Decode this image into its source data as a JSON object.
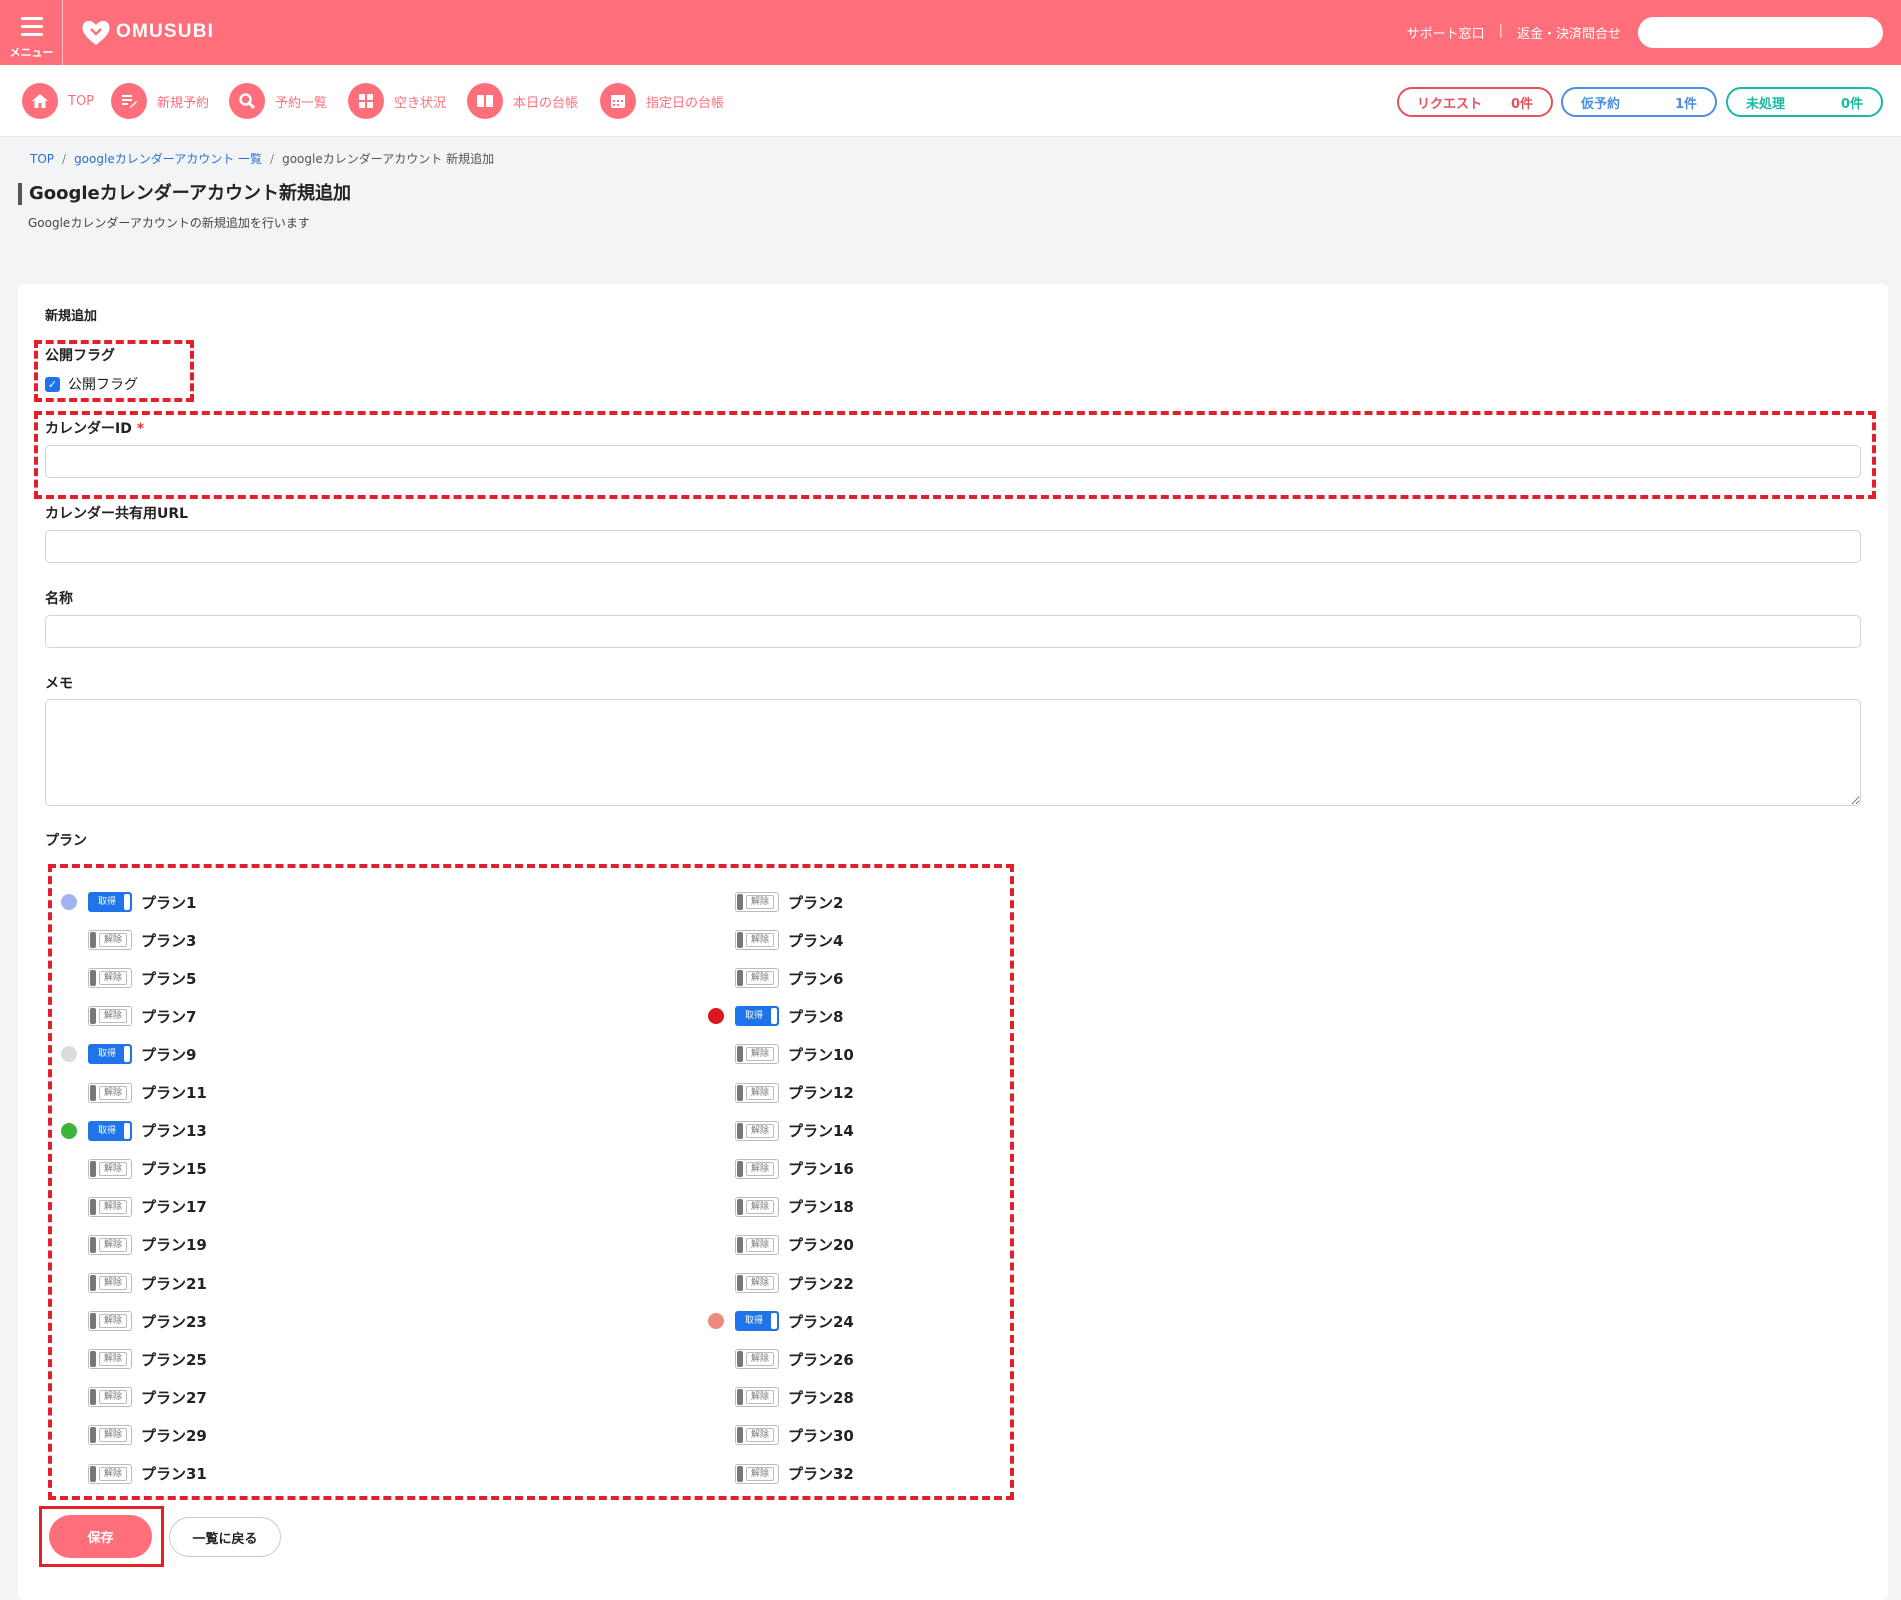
{
  "header": {
    "menu_label": "メニュー",
    "logo_text": "OMUSUBI",
    "support_link": "サポート窓口",
    "separator": "|",
    "refund_link": "返金・決済問合せ"
  },
  "nav": {
    "items": [
      {
        "label": "TOP",
        "icon": "home-icon"
      },
      {
        "label": "新規予約",
        "icon": "edit-icon"
      },
      {
        "label": "予約一覧",
        "icon": "search-icon"
      },
      {
        "label": "空き状況",
        "icon": "grid-icon"
      },
      {
        "label": "本日の台帳",
        "icon": "book-icon"
      },
      {
        "label": "指定日の台帳",
        "icon": "calendar-icon"
      }
    ]
  },
  "status": {
    "request": {
      "label": "リクエスト",
      "count": "0件",
      "color": "#e8505b"
    },
    "provisional": {
      "label": "仮予約",
      "count": "1件",
      "color": "#4a90e2"
    },
    "unprocessed": {
      "label": "未処理",
      "count": "0件",
      "color": "#17b8a6"
    }
  },
  "breadcrumb": {
    "top": "TOP",
    "sep": "/",
    "list": "googleカレンダーアカウント 一覧",
    "current": "googleカレンダーアカウント 新規追加"
  },
  "page": {
    "title": "Googleカレンダーアカウント新規追加",
    "subtitle": "Googleカレンダーアカウントの新規追加を行います"
  },
  "form": {
    "section_title": "新規追加",
    "public_flag_label": "公開フラグ",
    "public_flag_checkbox": "公開フラグ",
    "public_flag_checked": true,
    "calendar_id_label": "カレンダーID",
    "required_mark": "*",
    "calendar_id_value": "",
    "share_url_label": "カレンダー共有用URL",
    "share_url_value": "",
    "name_label": "名称",
    "name_value": "",
    "memo_label": "メモ",
    "memo_value": "",
    "plan_label": "プラン"
  },
  "plans": {
    "on_text": "取得",
    "off_text": "解除",
    "items": [
      {
        "name": "プラン1",
        "on": true,
        "dot": "#9fb4f0"
      },
      {
        "name": "プラン2",
        "on": false
      },
      {
        "name": "プラン3",
        "on": false
      },
      {
        "name": "プラン4",
        "on": false
      },
      {
        "name": "プラン5",
        "on": false
      },
      {
        "name": "プラン6",
        "on": false
      },
      {
        "name": "プラン7",
        "on": false
      },
      {
        "name": "プラン8",
        "on": true,
        "dot": "#d9191f"
      },
      {
        "name": "プラン9",
        "on": true,
        "dot": "#dcdcdc"
      },
      {
        "name": "プラン10",
        "on": false
      },
      {
        "name": "プラン11",
        "on": false
      },
      {
        "name": "プラン12",
        "on": false
      },
      {
        "name": "プラン13",
        "on": true,
        "dot": "#3cb43c"
      },
      {
        "name": "プラン14",
        "on": false
      },
      {
        "name": "プラン15",
        "on": false
      },
      {
        "name": "プラン16",
        "on": false
      },
      {
        "name": "プラン17",
        "on": false
      },
      {
        "name": "プラン18",
        "on": false
      },
      {
        "name": "プラン19",
        "on": false
      },
      {
        "name": "プラン20",
        "on": false
      },
      {
        "name": "プラン21",
        "on": false
      },
      {
        "name": "プラン22",
        "on": false
      },
      {
        "name": "プラン23",
        "on": false
      },
      {
        "name": "プラン24",
        "on": true,
        "dot": "#f08a7e"
      },
      {
        "name": "プラン25",
        "on": false
      },
      {
        "name": "プラン26",
        "on": false
      },
      {
        "name": "プラン27",
        "on": false
      },
      {
        "name": "プラン28",
        "on": false
      },
      {
        "name": "プラン29",
        "on": false
      },
      {
        "name": "プラン30",
        "on": false
      },
      {
        "name": "プラン31",
        "on": false
      },
      {
        "name": "プラン32",
        "on": false
      }
    ]
  },
  "actions": {
    "save": "保存",
    "back": "一覧に戻る"
  }
}
